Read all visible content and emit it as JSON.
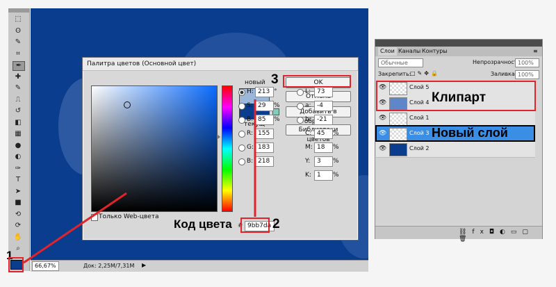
{
  "toolbar": {
    "icons": [
      "marquee-icon",
      "lasso-icon",
      "quick-select-icon",
      "crop-icon",
      "eyedropper-icon",
      "healing-icon",
      "brush-icon",
      "stamp-icon",
      "history-brush-icon",
      "eraser-icon",
      "gradient-icon",
      "blur-icon",
      "dodge-icon",
      "pen-icon",
      "type-icon",
      "path-select-icon",
      "shape-icon",
      "3d-rotate-icon",
      "3d-orbit-icon",
      "hand-icon",
      "zoom-icon"
    ]
  },
  "status": {
    "zoom": "66,67%",
    "doc": "Док: 2,25M/7,31M"
  },
  "dialog": {
    "title": "Палитра цветов (Основной цвет)",
    "new_label": "новый",
    "current_label": "текущ",
    "ok": "OK",
    "cancel": "Отмена",
    "add_swatches": "Добавить в образцы",
    "color_libraries": "Библиотеки цветов",
    "web_only": "Только Web-цвета",
    "new_color": "#9bb7da",
    "current_color": "#0b3d8e",
    "fields": {
      "H": {
        "label": "H:",
        "value": "213",
        "unit": "°"
      },
      "S": {
        "label": "S:",
        "value": "29",
        "unit": "%"
      },
      "Bv": {
        "label": "B:",
        "value": "85",
        "unit": "%"
      },
      "R": {
        "label": "R:",
        "value": "155",
        "unit": ""
      },
      "G": {
        "label": "G:",
        "value": "183",
        "unit": ""
      },
      "Bb": {
        "label": "B:",
        "value": "218",
        "unit": ""
      },
      "L": {
        "label": "L:",
        "value": "73",
        "unit": ""
      },
      "a": {
        "label": "a:",
        "value": "-4",
        "unit": ""
      },
      "b": {
        "label": "b:",
        "value": "-21",
        "unit": ""
      },
      "C": {
        "label": "C:",
        "value": "45",
        "unit": "%"
      },
      "M": {
        "label": "M:",
        "value": "18",
        "unit": "%"
      },
      "Y": {
        "label": "Y:",
        "value": "3",
        "unit": "%"
      },
      "K": {
        "label": "K:",
        "value": "1",
        "unit": "%"
      }
    },
    "hex_prefix": "#",
    "hex": "9bb7da"
  },
  "layers_panel": {
    "tabs": [
      "Слои",
      "Каналы",
      "Контуры"
    ],
    "blend_mode": "Обычные",
    "opacity_label": "Непрозрачность:",
    "opacity": "100%",
    "lock_label": "Закрепить:",
    "fill_label": "Заливка:",
    "fill": "100%",
    "layers": [
      {
        "name": "Слой 5"
      },
      {
        "name": "Слой 4"
      },
      {
        "name": "Слой 1"
      },
      {
        "name": "Слой 3"
      },
      {
        "name": "Слой 2"
      }
    ]
  },
  "annotations": {
    "one": "1",
    "two": "2",
    "three": "3",
    "clipart": "Клипарт",
    "new_layer": "Новый слой",
    "color_code": "Код цвета"
  }
}
